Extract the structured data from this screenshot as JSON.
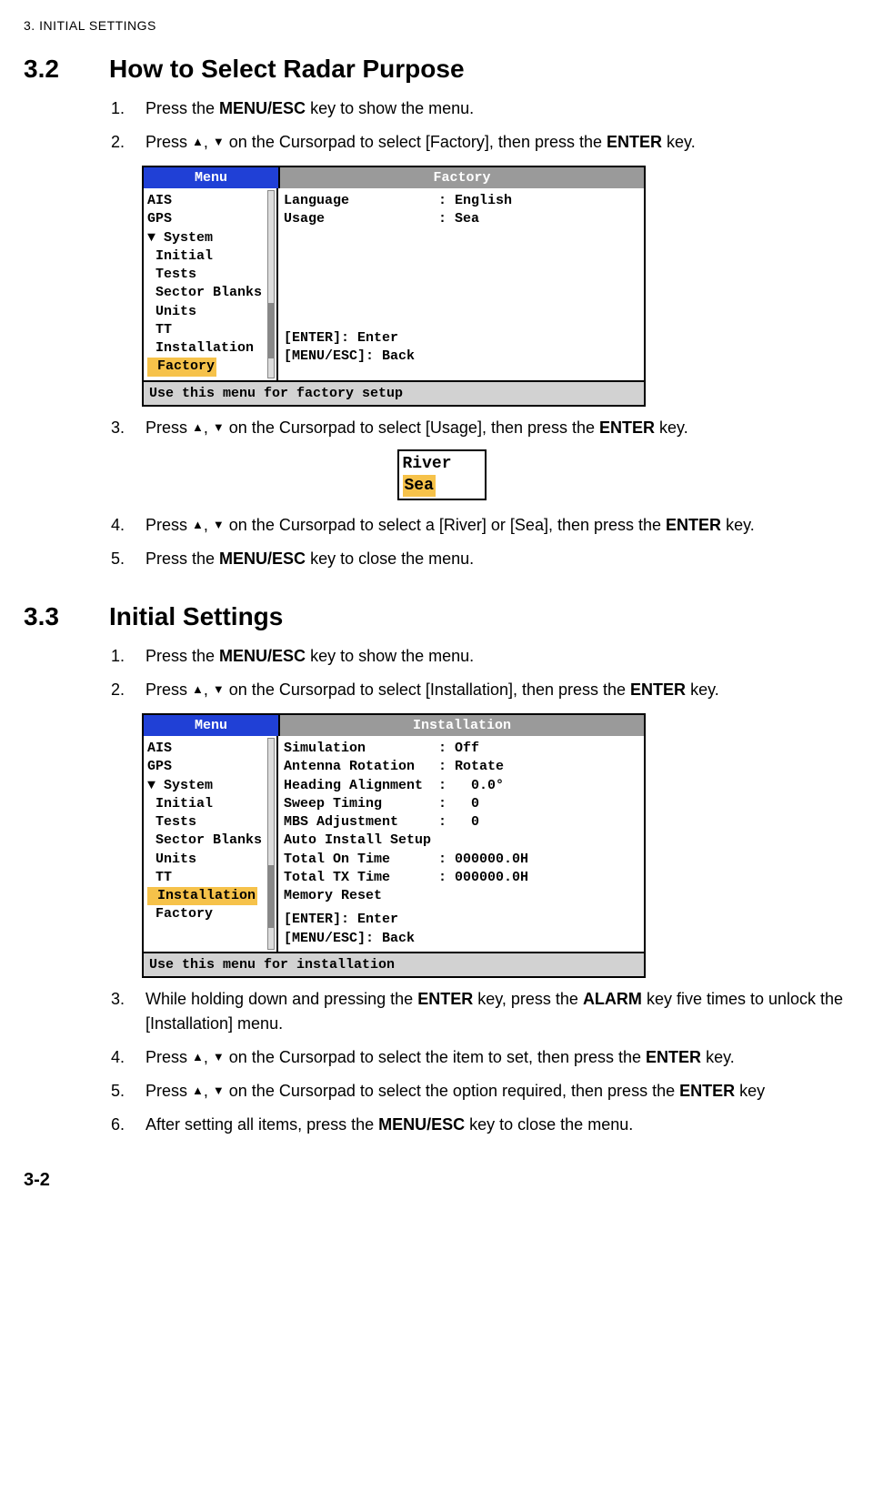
{
  "chapter_header": "3.  INITIAL SETTINGS",
  "page_number": "3-2",
  "s32": {
    "num": "3.2",
    "title": "How to Select Radar Purpose",
    "steps": {
      "1a": "Press the ",
      "1key": "MENU/ESC",
      "1b": " key to show the menu.",
      "2a": "Press ",
      "2b": " on the Cursorpad to select [Factory], then press the ",
      "2key": "ENTER",
      "2c": " key.",
      "3a": "Press ",
      "3b": " on the Cursorpad to select [Usage], then press the ",
      "3key": "ENTER",
      "3c": " key.",
      "4a": "Press ",
      "4b": " on the Cursorpad to select a [River] or [Sea], then press the ",
      "4key": "ENTER",
      "4c": " key.",
      "5a": "Press the ",
      "5key": "MENU/ESC",
      "5b": " key to close the menu."
    },
    "menu": {
      "leftcap": "Menu",
      "rightcap": "Factory",
      "left_items": [
        "AIS",
        "GPS",
        "",
        "▼ System",
        " Initial",
        " Tests",
        " Sector Blanks",
        " Units",
        " TT",
        " Installation"
      ],
      "left_sel": " Factory",
      "rows": [
        {
          "lab": "Language",
          "val": ": English"
        },
        {
          "lab": "Usage",
          "val": ": Sea"
        }
      ],
      "hints": [
        "[ENTER]: Enter",
        "[MENU/ESC]: Back"
      ],
      "bottom": "Use this menu for factory setup"
    },
    "popup": {
      "opt1": "River",
      "sel": "Sea"
    }
  },
  "s33": {
    "num": "3.3",
    "title": "Initial Settings",
    "steps": {
      "1a": "Press the ",
      "1key": "MENU/ESC",
      "1b": " key to show the menu.",
      "2a": "Press ",
      "2b": " on the Cursorpad to select [Installation], then press the ",
      "2key": "ENTER",
      "2c": " key.",
      "3a": "While holding down and pressing the ",
      "3key1": "ENTER",
      "3b": " key, press the ",
      "3key2": "ALARM",
      "3c": " key five times to unlock the [Installation] menu.",
      "4a": "Press ",
      "4b": " on the Cursorpad to select the item to set, then press the ",
      "4key": "ENTER",
      "4c": " key.",
      "5a": "Press ",
      "5b": " on the Cursorpad to select the option required, then press the ",
      "5key": "ENTER",
      "5c": " key",
      "6a": "After setting all items, press the ",
      "6key": "MENU/ESC",
      "6b": " key to close the menu."
    },
    "menu": {
      "leftcap": "Menu",
      "rightcap": "Installation",
      "left_items": [
        "AIS",
        "GPS",
        "",
        "▼ System",
        " Initial",
        " Tests",
        " Sector Blanks",
        " Units",
        " TT"
      ],
      "left_sel": " Installation",
      "left_after": [
        " Factory"
      ],
      "rows": [
        {
          "lab": "Simulation",
          "val": ": Off"
        },
        {
          "lab": "Antenna Rotation",
          "val": ": Rotate"
        },
        {
          "lab": "Heading Alignment",
          "val": ":   0.0°"
        },
        {
          "lab": "Sweep Timing",
          "val": ":   0"
        },
        {
          "lab": "MBS Adjustment",
          "val": ":   0"
        },
        {
          "lab": "Auto Install Setup",
          "val": ""
        },
        {
          "lab": "Total On Time",
          "val": ": 000000.0H"
        },
        {
          "lab": "Total TX Time",
          "val": ": 000000.0H"
        },
        {
          "lab": "Memory Reset",
          "val": ""
        }
      ],
      "hints": [
        "[ENTER]: Enter",
        "[MENU/ESC]: Back"
      ],
      "bottom": "Use this menu for installation"
    }
  }
}
